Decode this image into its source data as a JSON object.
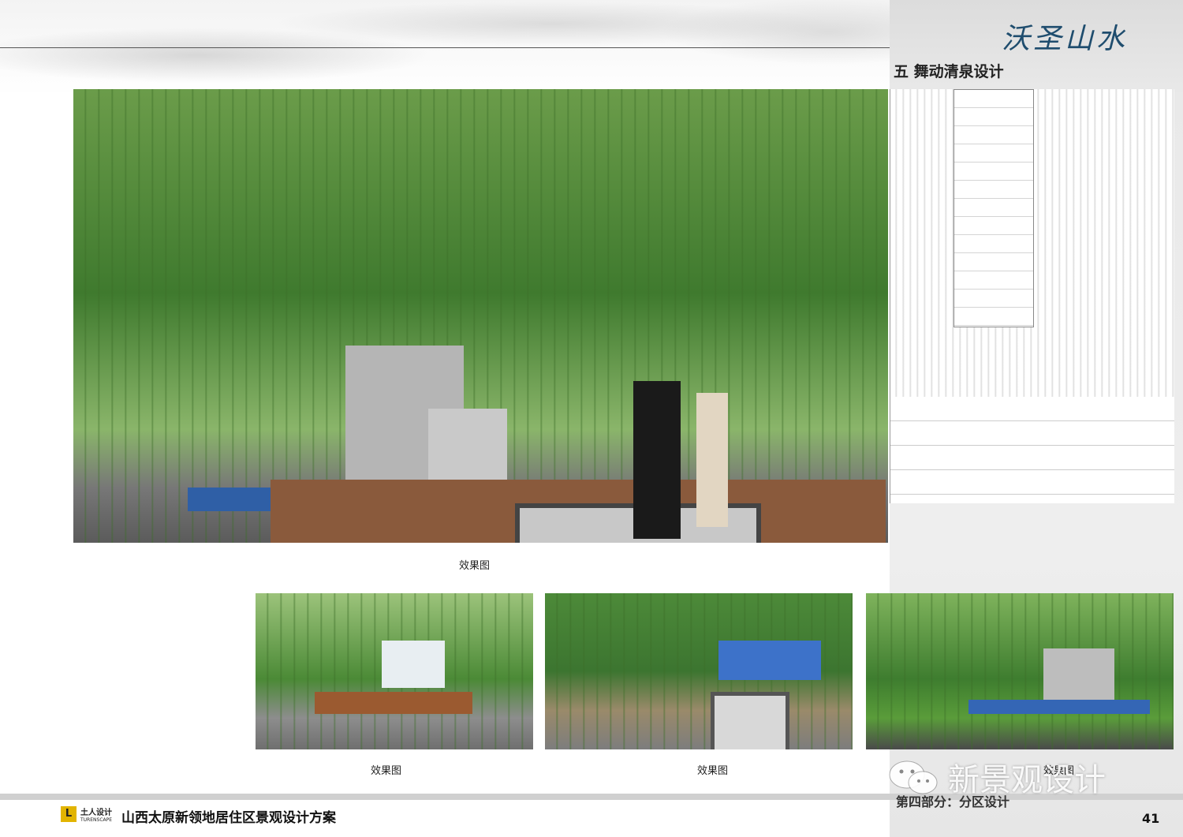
{
  "header": {
    "calligraphy": "沃圣山水",
    "section_title": "五  舞动清泉设计"
  },
  "captions": {
    "main": "效果图",
    "thumb1": "效果图",
    "thumb2": "效果图",
    "thumb3": "效果图"
  },
  "footer": {
    "logo_mark": "L",
    "logo_cn": "土人设计",
    "logo_en": "TURENSCAPE",
    "title": "山西太原新领地居住区景观设计方案",
    "part_label": "第四部分：分区设计",
    "page_number": "41"
  },
  "watermark": {
    "text": "新景观设计",
    "icon": "wechat-icon"
  }
}
